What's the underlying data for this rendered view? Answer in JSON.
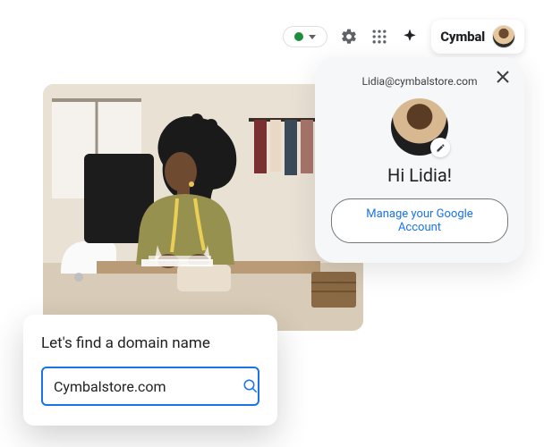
{
  "toolbar": {
    "status": "active",
    "status_color": "#1e8e3e",
    "brand": "Cymbal"
  },
  "account": {
    "email": "Lidia@cymbalstore.com",
    "greeting": "Hi Lidia!",
    "manage_label": "Manage your Google Account"
  },
  "domain_search": {
    "heading": "Let's find a domain name",
    "value": "Cymbalstore.com"
  },
  "colors": {
    "accent": "#1a73e8",
    "success": "#1e8e3e",
    "text": "#202124",
    "muted": "#5f6368"
  }
}
